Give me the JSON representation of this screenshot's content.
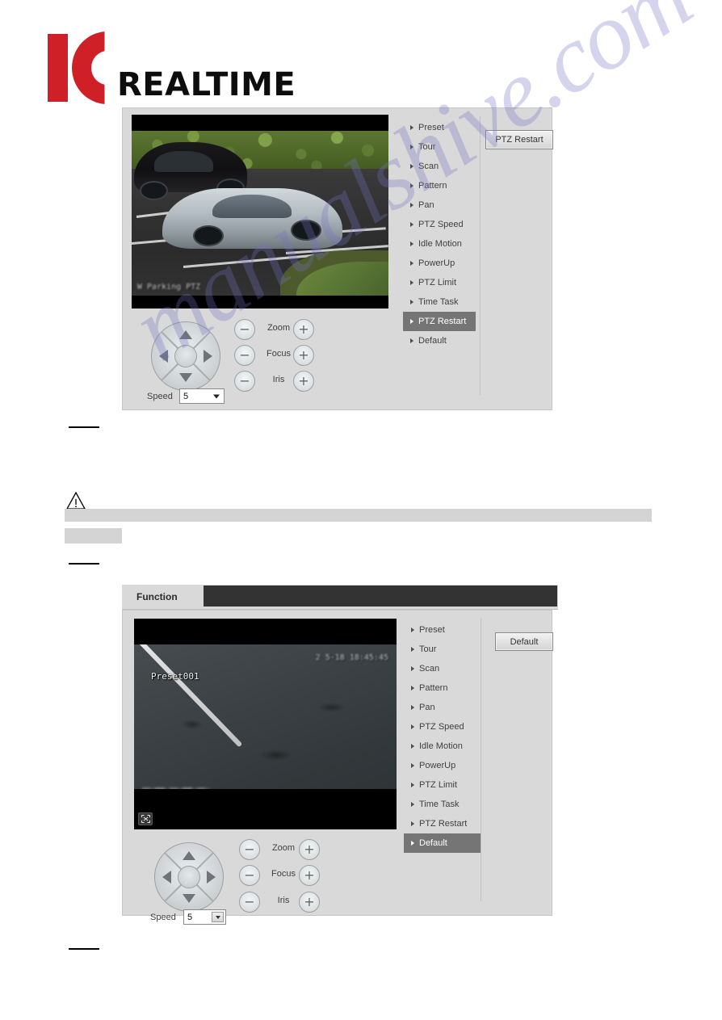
{
  "brand": {
    "logo_mark": "ic-logo",
    "logo_text": "REALTIME",
    "primary_color": "#cf2027"
  },
  "watermark": {
    "text": "manualshive.com",
    "color": "#7470c4"
  },
  "menu_items": [
    "Preset",
    "Tour",
    "Scan",
    "Pattern",
    "Pan",
    "PTZ Speed",
    "Idle Motion",
    "PowerUp",
    "PTZ Limit",
    "Time Task",
    "PTZ Restart",
    "Default"
  ],
  "ptz_controls": {
    "zoom_label": "Zoom",
    "focus_label": "Focus",
    "iris_label": "Iris",
    "minus_glyph": "−",
    "plus_glyph": "+",
    "speed_label": "Speed",
    "speed_value": "5",
    "joystick_up": "up-arrow",
    "joystick_down": "down-arrow",
    "joystick_left": "left-arrow",
    "joystick_right": "right-arrow"
  },
  "panel_one": {
    "active_menu_item": "PTZ Restart",
    "button_label": "PTZ Restart",
    "video_osd_label": "W Parking PTZ"
  },
  "panel_two": {
    "tab_label": "Function",
    "active_menu_item": "Default",
    "button_label": "Default",
    "video_osd_preset": "Preset001",
    "video_osd_timestamp": "2   5-18 18:45:45",
    "fullscreen_icon": "fullscreen-icon"
  },
  "document_marks": {
    "warning_icon": "warning-triangle-icon",
    "redacted_caption_note": ""
  }
}
